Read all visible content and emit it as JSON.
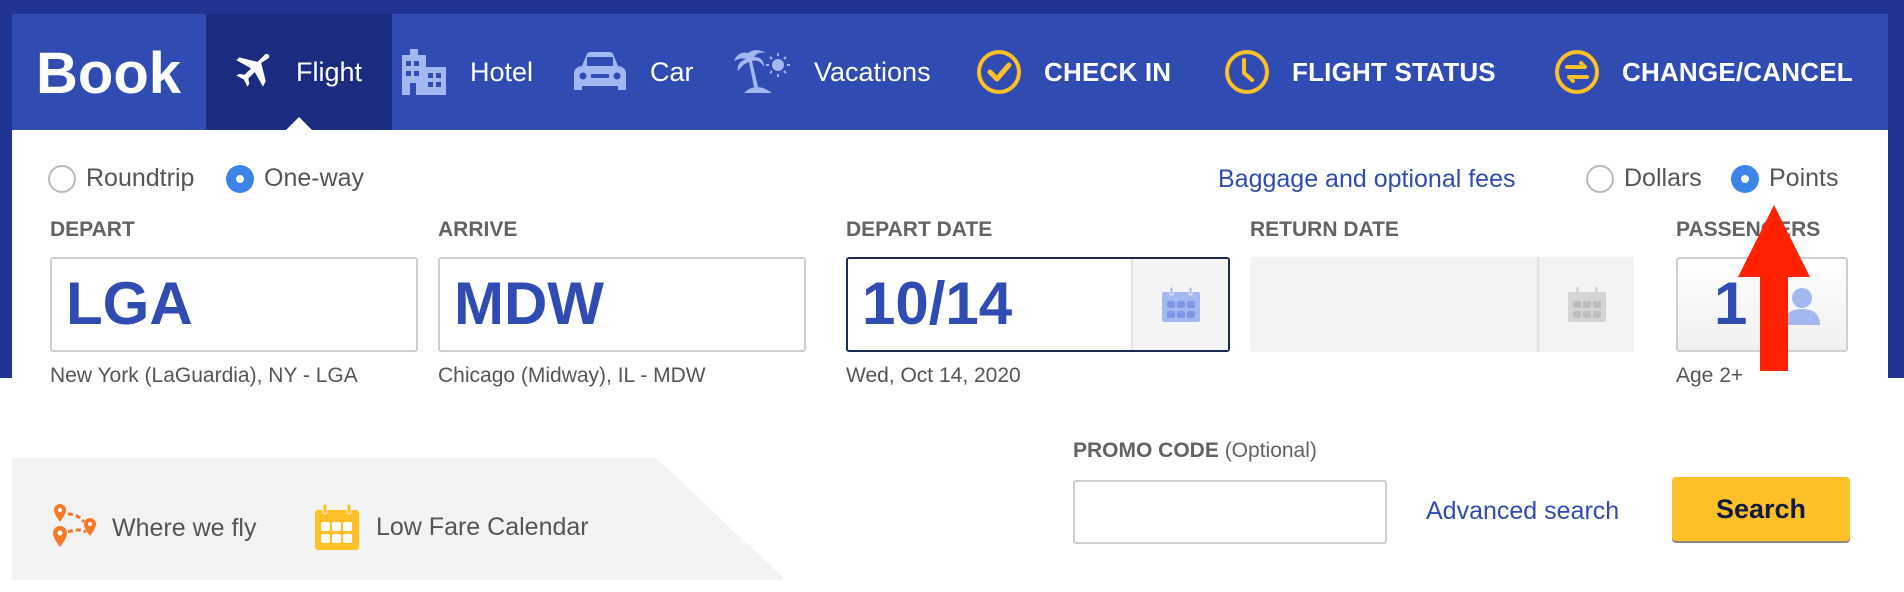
{
  "nav": {
    "book_label": "Book",
    "tabs": [
      {
        "label": "Flight",
        "icon": "airplane-icon",
        "active": true
      },
      {
        "label": "Hotel",
        "icon": "hotel-building-icon",
        "active": false
      },
      {
        "label": "Car",
        "icon": "car-icon",
        "active": false
      },
      {
        "label": "Vacations",
        "icon": "palm-tree-sun-icon",
        "active": false
      }
    ],
    "actions": [
      {
        "label": "CHECK IN",
        "icon": "check-circle-icon"
      },
      {
        "label": "FLIGHT STATUS",
        "icon": "clock-icon"
      },
      {
        "label": "CHANGE/CANCEL",
        "icon": "swap-arrows-icon"
      }
    ]
  },
  "trip_type": {
    "options": [
      "Roundtrip",
      "One-way"
    ],
    "selected": "One-way"
  },
  "baggage_link": "Baggage and optional fees",
  "currency": {
    "options": [
      "Dollars",
      "Points"
    ],
    "selected": "Points"
  },
  "depart": {
    "label": "DEPART",
    "value": "LGA",
    "description": "New York (LaGuardia), NY - LGA"
  },
  "arrive": {
    "label": "ARRIVE",
    "value": "MDW",
    "description": "Chicago (Midway), IL - MDW"
  },
  "depart_date": {
    "label": "DEPART DATE",
    "value": "10/14",
    "description": "Wed, Oct 14, 2020"
  },
  "return_date": {
    "label": "RETURN DATE",
    "value": "",
    "disabled": true
  },
  "passengers": {
    "label": "PASSENGERS",
    "value": "1",
    "description": "Age 2+"
  },
  "quick_links": [
    {
      "label": "Where we fly",
      "icon": "map-route-pins-icon"
    },
    {
      "label": "Low Fare Calendar",
      "icon": "calendar-icon"
    }
  ],
  "promo": {
    "label": "PROMO CODE",
    "optional": "(Optional)",
    "value": "",
    "placeholder": ""
  },
  "advanced_search": "Advanced search",
  "search_button": "Search",
  "annotation": {
    "type": "red-arrow",
    "points_to": "Points"
  },
  "colors": {
    "nav_bg": "#304cb2",
    "nav_active": "#1b2b7f",
    "page_dark": "#223493",
    "accent_yellow": "#ffbf27",
    "link_blue": "#304cb2",
    "radio_blue": "#3a84ea",
    "icon_light_blue": "#a3b8f0",
    "orange": "#f5792a",
    "annotation_red": "#ff2200"
  }
}
